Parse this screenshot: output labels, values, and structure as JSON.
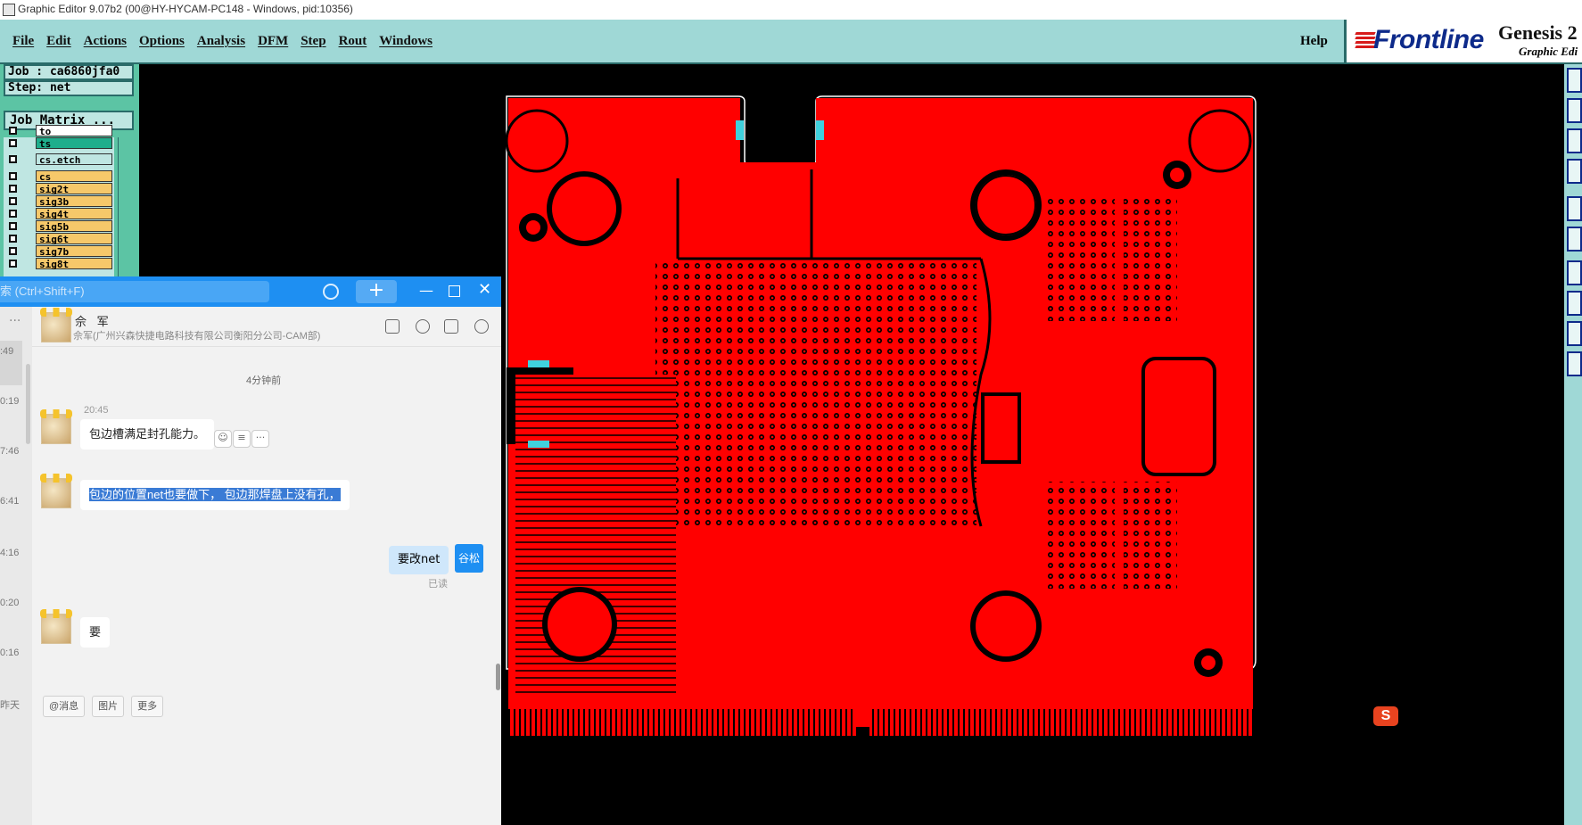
{
  "window": {
    "title": "Graphic Editor 9.07b2 (00@HY-HYCAM-PC148 - Windows, pid:10356)"
  },
  "menubar": {
    "items": [
      "File",
      "Edit",
      "Actions",
      "Options",
      "Analysis",
      "DFM",
      "Step",
      "Rout",
      "Windows"
    ],
    "help": "Help"
  },
  "brand": {
    "logo": "Frontline",
    "product": "Genesis 2",
    "subtitle": "Graphic Edi"
  },
  "job": {
    "job_line": "Job : ca6860jfa0",
    "step_line": "Step: net",
    "matrix_button": "Job Matrix ..."
  },
  "layers": [
    {
      "name": "to",
      "color": "#ffffff"
    },
    {
      "name": "ts",
      "color": "#1fae8c"
    },
    {
      "name": "cs.etch",
      "color": "#bfe6e2"
    },
    {
      "name": "cs",
      "color": "#f6c86a"
    },
    {
      "name": "sig2t",
      "color": "#f6c86a"
    },
    {
      "name": "sig3b",
      "color": "#f6c86a"
    },
    {
      "name": "sig4t",
      "color": "#f6c86a"
    },
    {
      "name": "sig5b",
      "color": "#f6c86a"
    },
    {
      "name": "sig6t",
      "color": "#f6c86a"
    },
    {
      "name": "sig7b",
      "color": "#f6c86a"
    },
    {
      "name": "sig8t",
      "color": "#f6c86a"
    }
  ],
  "chat": {
    "search_placeholder": "索 (Ctrl+Shift+F)",
    "plus": "+",
    "contact_name": "佘 军",
    "contact_sub": "佘军(广州兴森快捷电路科技有限公司衡阳分公司-CAM部)",
    "timeline_label": "4分钟前",
    "msg_time": "20:45",
    "messages": [
      "包边槽满足封孔能力。",
      "包边的位置net也要做下， 包边那焊盘上没有孔，",
      "要改net",
      "要"
    ],
    "my_avatar_label": "谷松",
    "read_status": "已读",
    "left_times": [
      ":49",
      "0:19",
      "7:46",
      "6:41",
      "4:16",
      "0:20",
      "0:16",
      "昨天"
    ],
    "input_tools": [
      "@消息",
      "图片",
      "更多"
    ]
  },
  "colors": {
    "menubar_bg": "#9fd8d6",
    "pcb_copper": "#ff0000",
    "chat_accent": "#1e8ff2"
  }
}
